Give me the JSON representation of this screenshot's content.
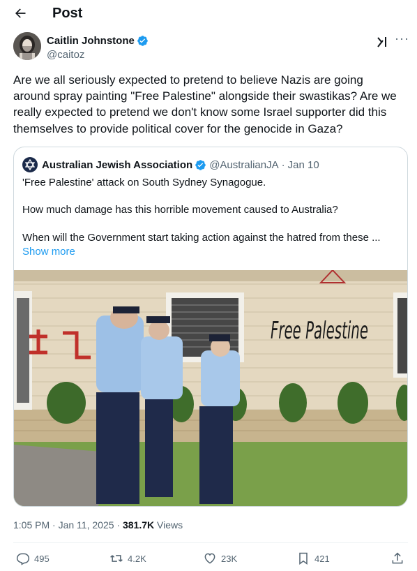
{
  "header": {
    "title": "Post"
  },
  "author": {
    "name": "Caitlin Johnstone",
    "handle": "@caitoz"
  },
  "post": {
    "lines": [
      "Are we all seriously expected to pretend to believe Nazis are going",
      "around spray painting \"Free Palestine\" alongside their swastikas? Are we",
      "really expected to pretend we don't know some Israel supporter did this",
      "themselves to provide political cover for the genocide in Gaza?"
    ]
  },
  "quote": {
    "name": "Australian Jewish Association",
    "handle": "@AustralianJA",
    "separator": "·",
    "date": "Jan 10",
    "lines": [
      "'Free Palestine' attack on South Sydney Synagogue.",
      "How much damage has this horrible movement caused to Australia?",
      "When will the Government start taking action against the hatred from these ..."
    ],
    "show_more": "Show more",
    "graffiti_text": "Free Palestine"
  },
  "meta": {
    "time": "1:05 PM",
    "dot1": "·",
    "date": "Jan 11, 2025",
    "dot2": "·",
    "views_count": "381.7K",
    "views_label": "Views"
  },
  "actions": {
    "replies": "495",
    "reposts": "4.2K",
    "likes": "23K",
    "bookmarks": "421"
  },
  "colors": {
    "accent": "#1d9bf0",
    "text": "#0f1419",
    "muted": "#536471",
    "border": "#cfd9de"
  },
  "icons": [
    "back-arrow-icon",
    "verified-badge-icon",
    "grok-icon",
    "more-icon",
    "star-of-david-icon",
    "reply-icon",
    "repost-icon",
    "like-icon",
    "bookmark-icon",
    "share-icon"
  ]
}
